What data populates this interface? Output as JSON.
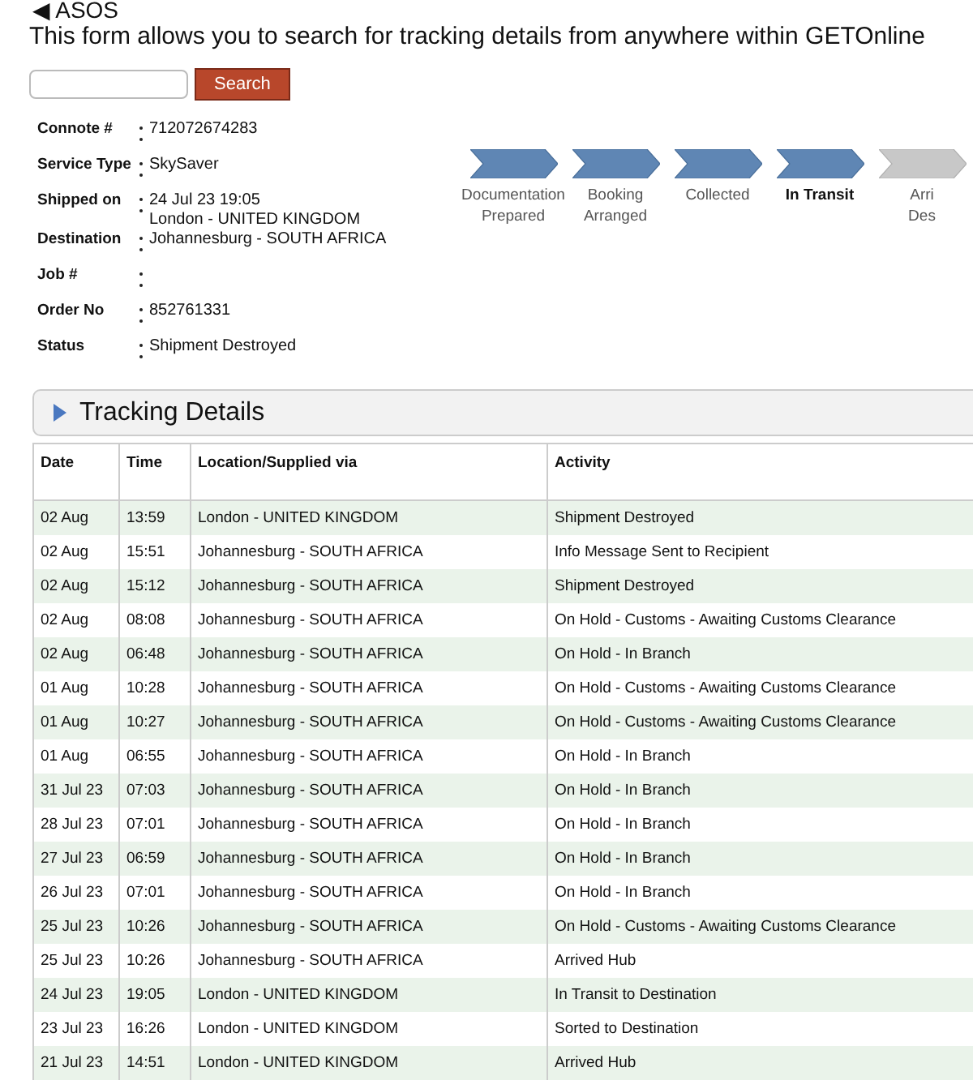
{
  "back_link": "◀ ASOS",
  "intro": "This form allows you to search for tracking details from anywhere within GETOnline",
  "search": {
    "button": "Search"
  },
  "details": [
    {
      "label": "Connote #",
      "values": [
        "712072674283"
      ]
    },
    {
      "label": "Service Type",
      "values": [
        "SkySaver"
      ]
    },
    {
      "label": "Shipped on",
      "values": [
        "24 Jul 23 19:05",
        "London - UNITED KINGDOM"
      ]
    },
    {
      "label": "Destination",
      "values": [
        "Johannesburg - SOUTH AFRICA"
      ]
    },
    {
      "label": "Job #"
    },
    {
      "label": "Order No",
      "values": [
        "852761331"
      ]
    },
    {
      "label": "Status",
      "values": [
        "Shipment Destroyed"
      ]
    }
  ],
  "steps": [
    {
      "lines": [
        "Documentation",
        "Prepared"
      ],
      "completed": true,
      "selected": false
    },
    {
      "lines": [
        "Booking",
        "Arranged"
      ],
      "completed": true,
      "selected": false
    },
    {
      "lines": [
        "Collected"
      ],
      "completed": true,
      "selected": false
    },
    {
      "lines": [
        "In Transit"
      ],
      "completed": true,
      "selected": true
    },
    {
      "lines": [
        "Arri",
        "Des"
      ],
      "completed": false,
      "selected": false
    }
  ],
  "tracking": {
    "title": "Tracking Details",
    "columns": [
      "Date",
      "Time",
      "Location/Supplied via",
      "Activity"
    ],
    "rows": [
      [
        "02 Aug",
        "13:59",
        "London - UNITED KINGDOM",
        "Shipment Destroyed"
      ],
      [
        "02 Aug",
        "15:51",
        "Johannesburg - SOUTH AFRICA",
        "Info Message Sent to Recipient"
      ],
      [
        "02 Aug",
        "15:12",
        "Johannesburg - SOUTH AFRICA",
        "Shipment Destroyed"
      ],
      [
        "02 Aug",
        "08:08",
        "Johannesburg - SOUTH AFRICA",
        "On Hold - Customs - Awaiting Customs Clearance"
      ],
      [
        "02 Aug",
        "06:48",
        "Johannesburg - SOUTH AFRICA",
        "On Hold - In Branch"
      ],
      [
        "01 Aug",
        "10:28",
        "Johannesburg - SOUTH AFRICA",
        "On Hold - Customs - Awaiting Customs Clearance"
      ],
      [
        "01 Aug",
        "10:27",
        "Johannesburg - SOUTH AFRICA",
        "On Hold - Customs - Awaiting Customs Clearance"
      ],
      [
        "01 Aug",
        "06:55",
        "Johannesburg - SOUTH AFRICA",
        "On Hold - In Branch"
      ],
      [
        "31 Jul 23",
        "07:03",
        "Johannesburg - SOUTH AFRICA",
        "On Hold - In Branch"
      ],
      [
        "28 Jul 23",
        "07:01",
        "Johannesburg - SOUTH AFRICA",
        "On Hold - In Branch"
      ],
      [
        "27 Jul 23",
        "06:59",
        "Johannesburg - SOUTH AFRICA",
        "On Hold - In Branch"
      ],
      [
        "26 Jul 23",
        "07:01",
        "Johannesburg - SOUTH AFRICA",
        "On Hold - In Branch"
      ],
      [
        "25 Jul 23",
        "10:26",
        "Johannesburg - SOUTH AFRICA",
        "On Hold - Customs - Awaiting Customs Clearance"
      ],
      [
        "25 Jul 23",
        "10:26",
        "Johannesburg - SOUTH AFRICA",
        "Arrived Hub"
      ],
      [
        "24 Jul 23",
        "19:05",
        "London - UNITED KINGDOM",
        "In Transit to Destination"
      ],
      [
        "23 Jul 23",
        "16:26",
        "London - UNITED KINGDOM",
        "Sorted to Destination"
      ],
      [
        "21 Jul 23",
        "14:51",
        "London - UNITED KINGDOM",
        "Arrived Hub"
      ]
    ]
  }
}
